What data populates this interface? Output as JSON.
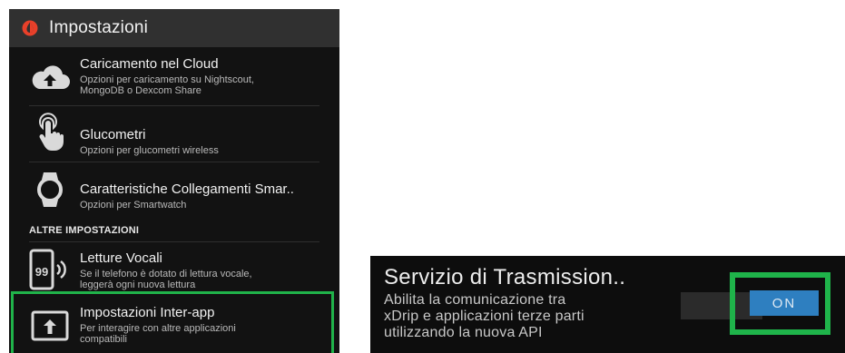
{
  "appbar": {
    "title": "Impostazioni"
  },
  "settings": [
    {
      "title": "Caricamento nel Cloud",
      "subtitle_lines": [
        "Opzioni per caricamento su Nightscout,",
        "MongoDB o Dexcom Share"
      ]
    },
    {
      "title": "Glucometri",
      "subtitle_lines": [
        "Opzioni per glucometri wireless"
      ]
    },
    {
      "title": "Caratteristiche Collegamenti Smar..",
      "subtitle_lines": [
        "Opzioni per Smartwatch"
      ]
    }
  ],
  "section_header": "ALTRE IMPOSTAZIONI",
  "other_settings": [
    {
      "title": "Letture Vocali",
      "subtitle_lines": [
        "Se il telefono è dotato di lettura vocale,",
        "leggerà ogni nuova lettura"
      ],
      "icon_text": "99"
    },
    {
      "title": "Impostazioni Inter-app",
      "subtitle_lines": [
        "Per interagire con altre applicazioni",
        "compatibili"
      ]
    }
  ],
  "broadcast": {
    "title": "Servizio di Trasmission..",
    "desc_lines": [
      "Abilita la comunicazione tra",
      "xDrip e applicazioni terze parti",
      "utilizzando la nuova API"
    ],
    "toggle_label": "ON"
  },
  "colors": {
    "accent_green": "#20b34a",
    "toggle_blue": "#2e7fc0",
    "app_red": "#e8402a"
  }
}
